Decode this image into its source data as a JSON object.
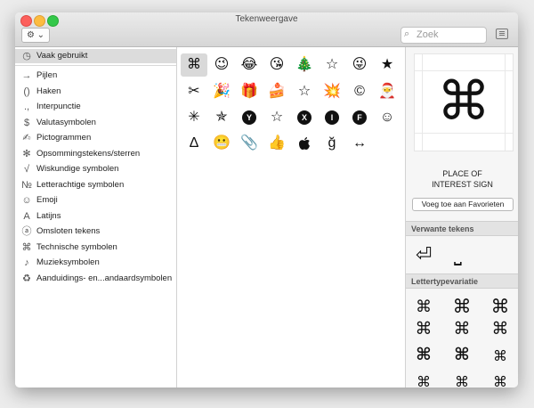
{
  "window": {
    "title": "Tekenweergave"
  },
  "toolbar": {
    "gear_label": "⚙ ⌄",
    "search_placeholder": "Zoek"
  },
  "sidebar": {
    "items": [
      {
        "icon": "◷",
        "label": "Vaak gebruikt",
        "name": "sidebar-item-vaak-gebruikt"
      },
      {
        "icon": "→",
        "label": "Pijlen",
        "name": "sidebar-item-pijlen"
      },
      {
        "icon": "()",
        "label": "Haken",
        "name": "sidebar-item-haken"
      },
      {
        "icon": ".,",
        "label": "Interpunctie",
        "name": "sidebar-item-interpunctie"
      },
      {
        "icon": "$",
        "label": "Valutasymbolen",
        "name": "sidebar-item-valutasymbolen"
      },
      {
        "icon": "✍",
        "label": "Pictogrammen",
        "name": "sidebar-item-pictogrammen"
      },
      {
        "icon": "✻",
        "label": "Opsommingstekens/sterren",
        "name": "sidebar-item-opsommingstekens"
      },
      {
        "icon": "√",
        "label": "Wiskundige symbolen",
        "name": "sidebar-item-wiskundige-symbolen"
      },
      {
        "icon": "№",
        "label": "Letterachtige symbolen",
        "name": "sidebar-item-letterachtige-symbolen"
      },
      {
        "icon": "☺",
        "label": "Emoji",
        "name": "sidebar-item-emoji"
      },
      {
        "icon": "A",
        "label": "Latijns",
        "name": "sidebar-item-latijns"
      },
      {
        "icon": "ⓐ",
        "label": "Omsloten tekens",
        "name": "sidebar-item-omsloten-tekens"
      },
      {
        "icon": "⌘",
        "label": "Technische symbolen",
        "name": "sidebar-item-technische-symbolen"
      },
      {
        "icon": "♪",
        "label": "Muzieksymbolen",
        "name": "sidebar-item-muzieksymbolen"
      },
      {
        "icon": "♻",
        "label": "Aanduidings- en...andaardsymbolen",
        "name": "sidebar-item-aanduidingssymbolen"
      }
    ]
  },
  "grid": {
    "rows": [
      [
        "⌘",
        "😉",
        "😂",
        "😘",
        "🎄",
        "☆",
        "😜",
        "★"
      ],
      [
        "✂",
        "🎉",
        "🎁",
        "🍰",
        "☆",
        "💥",
        "©",
        "🎅"
      ],
      [
        "✳",
        "✯",
        "Y",
        "☆",
        "X",
        "I",
        "F",
        "☺"
      ],
      [
        "∆",
        "😬",
        "📎",
        "👍",
        "",
        "ğ",
        "↔"
      ]
    ]
  },
  "detail": {
    "preview_char": "⌘",
    "char_name_line1": "PLACE OF",
    "char_name_line2": "INTEREST SIGN",
    "favorite_button": "Voeg toe aan Favorieten",
    "related_header": "Verwante tekens",
    "related": [
      "⏎",
      "⎵"
    ],
    "font_var_header": "Lettertypevariatie",
    "font_variations": [
      "⌘",
      "⌘",
      "⌘",
      "⌘",
      "⌘",
      "⌘",
      "⌘",
      "⌘",
      "⌘",
      "⌘",
      "⌘",
      "⌘"
    ]
  }
}
